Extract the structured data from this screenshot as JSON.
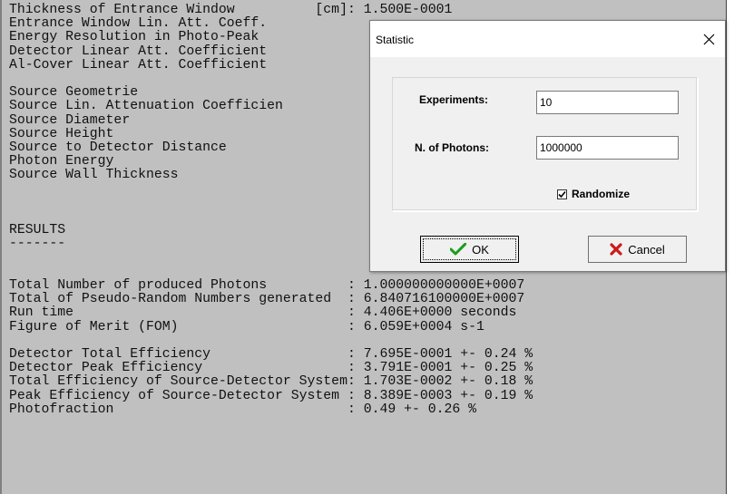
{
  "console": {
    "lines": [
      "Thickness of Entrance Window          [cm]: 1.500E-0001",
      "Entrance Window Lin. Att. Coeff.",
      "Energy Resolution in Photo-Peak",
      "Detector Linear Att. Coefficient",
      "Al-Cover Linear Att. Coefficient",
      "",
      "Source Geometrie",
      "Source Lin. Attenuation Coefficien",
      "Source Diameter",
      "Source Height",
      "Source to Detector Distance",
      "Photon Energy",
      "Source Wall Thickness",
      "",
      "",
      "",
      "RESULTS",
      "-------",
      "",
      "",
      "Total Number of produced Photons          : 1.000000000000E+0007",
      "Total of Pseudo-Random Numbers generated  : 6.840716100000E+0007",
      "Run time                                  : 4.406E+0000 seconds",
      "Figure of Merit (FOM)                     : 6.059E+0004 s-1",
      "",
      "Detector Total Efficiency                 : 7.695E-0001 +- 0.24 %",
      "Detector Peak Efficiency                  : 3.791E-0001 +- 0.25 %",
      "Total Efficiency of Source-Detector System: 1.703E-0002 +- 0.18 %",
      "Peak Efficiency of Source-Detector System : 8.389E-0003 +- 0.19 %",
      "Photofraction                             : 0.49 +- 0.26 %"
    ]
  },
  "dialog": {
    "title": "Statistic",
    "close_icon": "close-icon",
    "experiments_label": "Experiments:",
    "experiments_value": "10",
    "photons_label": "N. of Photons:",
    "photons_value": "1000000",
    "randomize_label": "Randomize",
    "randomize_checked": true,
    "ok_label": "OK",
    "ok_icon": "checkmark-icon",
    "ok_icon_color": "#1a9e1a",
    "cancel_label": "Cancel",
    "cancel_icon": "x-mark-icon",
    "cancel_icon_color": "#cc1a1a"
  }
}
